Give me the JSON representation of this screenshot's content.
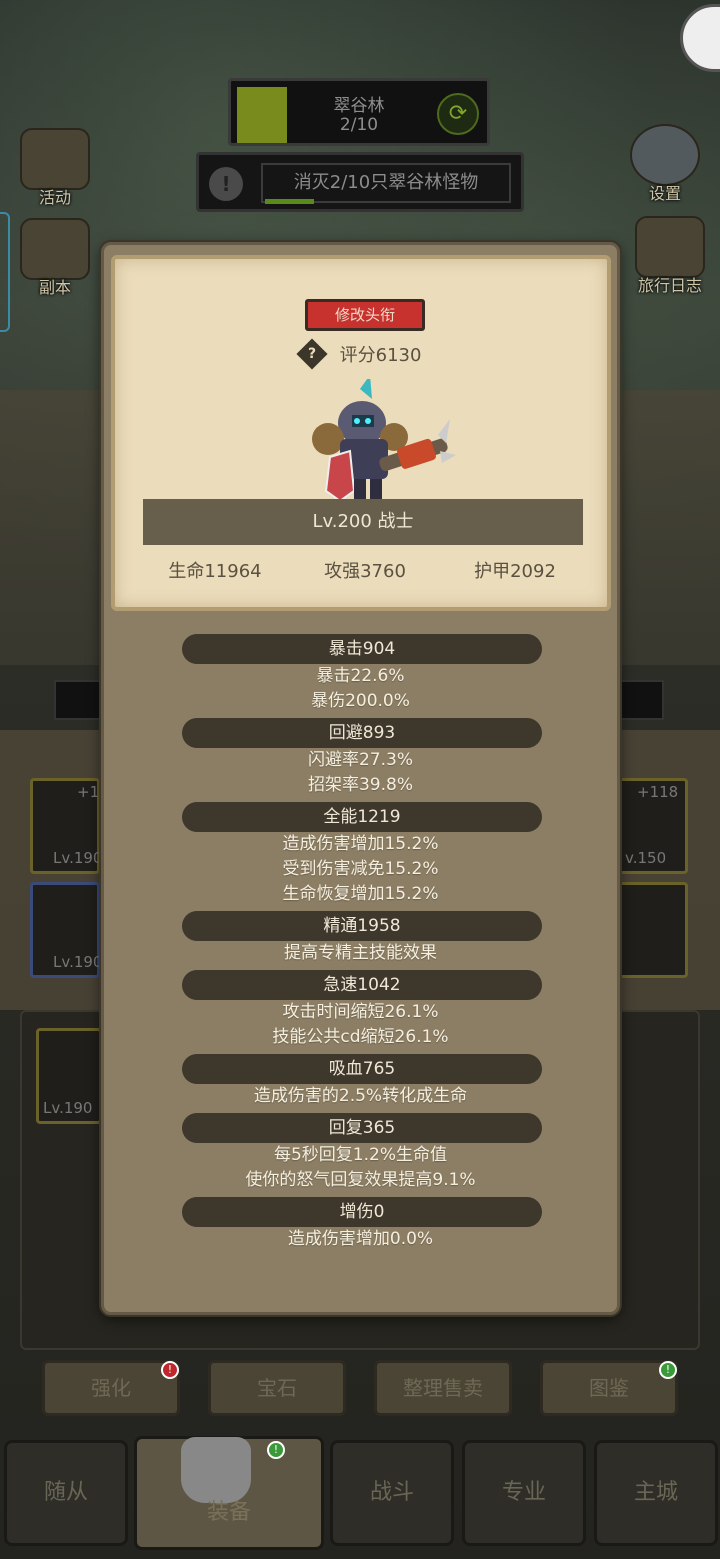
{
  "hud": {
    "zone_name": "翠谷林",
    "zone_progress": "2/10",
    "zone_fill_fraction": 0.2,
    "quest_text": "消灭2/10只翠谷林怪物",
    "quest_fill_fraction": 0.2,
    "refresh_icon": "refresh-icon",
    "quest_icon": "exclamation-icon"
  },
  "side_buttons": {
    "activity": "活动",
    "dungeon": "副本",
    "settings": "设置",
    "journal": "旅行日志"
  },
  "panel": {
    "rename_label": "修改头衔",
    "score_label": "评分6130",
    "help_symbol": "?",
    "level_class": "Lv.200 战士",
    "main_stats": [
      "生命11964",
      "攻强3760",
      "护甲2092"
    ],
    "sections": [
      {
        "header": "暴击904",
        "lines": [
          "暴击22.6%",
          "暴伤200.0%"
        ]
      },
      {
        "header": "回避893",
        "lines": [
          "闪避率27.3%",
          "招架率39.8%"
        ]
      },
      {
        "header": "全能1219",
        "lines": [
          "造成伤害增加15.2%",
          "受到伤害减免15.2%",
          "生命恢复增加15.2%"
        ]
      },
      {
        "header": "精通1958",
        "lines": [
          "提高专精主技能效果"
        ]
      },
      {
        "header": "急速1042",
        "lines": [
          "攻击时间缩短26.1%",
          "技能公共cd缩短26.1%"
        ]
      },
      {
        "header": "吸血765",
        "lines": [
          "造成伤害的2.5%转化成生命"
        ]
      },
      {
        "header": "回复365",
        "lines": [
          "每5秒回复1.2%生命值",
          "使你的怒气回复效果提高9.1%"
        ]
      },
      {
        "header": "增伤0",
        "lines": [
          "造成伤害增加0.0%"
        ]
      }
    ]
  },
  "background_slots": {
    "slot_a_level": "Lv.190",
    "slot_a_plus": "+1",
    "slot_b_level": "Lv.190",
    "slot_c_level": "v.150",
    "slot_c_plus": "+118",
    "slot_d_level": "Lv.190"
  },
  "function_buttons": [
    "强化",
    "宝石",
    "整理售卖",
    "图鉴"
  ],
  "nav_buttons": [
    "随从",
    "装备",
    "战斗",
    "专业",
    "主城"
  ],
  "colors": {
    "panel": "#8c7e64",
    "card": "#ebdcbb",
    "rename_button": "#c8322e",
    "stat_header": "#3e372c",
    "zone_fill": "#7a8b1d"
  }
}
